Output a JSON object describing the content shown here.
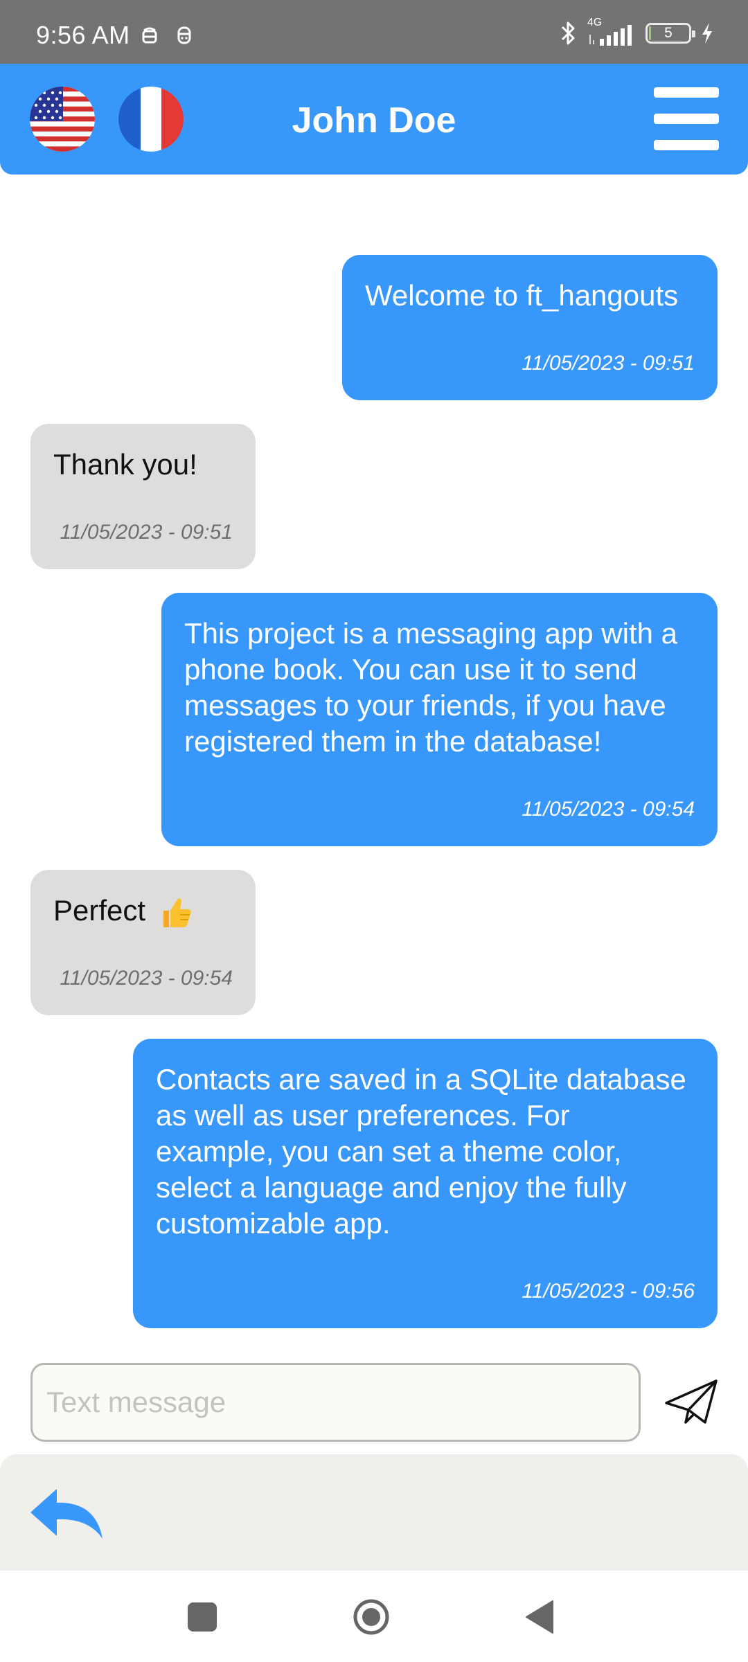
{
  "status_bar": {
    "time": "9:56 AM",
    "network": "4G",
    "battery": "5",
    "battery_level_percent": 5,
    "icons": [
      "notification-icon",
      "notification-icon",
      "bluetooth-icon",
      "signal-icon",
      "battery-icon",
      "charging-icon"
    ]
  },
  "header": {
    "title": "John Doe",
    "language_flags": [
      "us-flag-icon",
      "france-flag-icon"
    ],
    "menu_icon": "hamburger-menu-icon"
  },
  "messages": [
    {
      "direction": "sent",
      "text": "Welcome to ft_hangouts",
      "time": "11/05/2023 - 09:51"
    },
    {
      "direction": "received",
      "text": "Thank you!",
      "time": "11/05/2023 - 09:51"
    },
    {
      "direction": "sent",
      "text": "This project is a messaging app with a phone book. You can use it to send messages to your friends, if you have registered them in the database!",
      "time": "11/05/2023 - 09:54"
    },
    {
      "direction": "received",
      "text": "Perfect",
      "emoji": "thumbs-up-icon",
      "time": "11/05/2023 - 09:54"
    },
    {
      "direction": "sent",
      "text": "Contacts are saved in a SQLite database as well as user preferences. For example, you can set a theme color, select a language and enjoy the fully customizable app.",
      "time": "11/05/2023 - 09:56"
    }
  ],
  "composer": {
    "placeholder": "Text message",
    "value": "",
    "send_icon": "send-icon"
  },
  "bottom_bar": {
    "back_icon": "reply-back-icon"
  },
  "colors": {
    "accent": "#3897fb",
    "received_bubble": "#dedddb",
    "status_bar": "#737373",
    "bottom_bar": "#efefeb"
  }
}
